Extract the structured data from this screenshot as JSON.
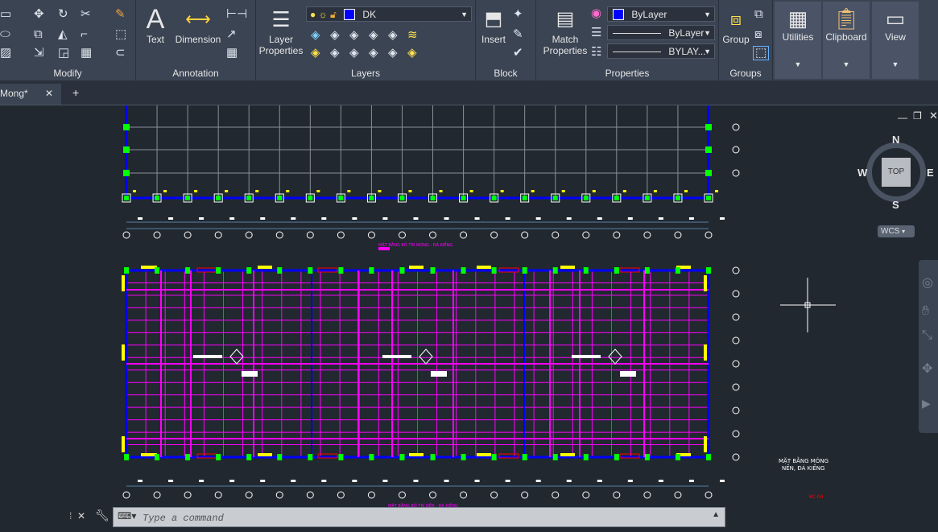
{
  "ribbon": {
    "modify_label": "Modify",
    "annotation_label": "Annotation",
    "annotation_text": "Text",
    "annotation_dimension": "Dimension",
    "layers_label": "Layers",
    "layer_properties": [
      "Layer",
      "Properties"
    ],
    "layer_current": "DK",
    "block_label": "Block",
    "insert": "Insert",
    "properties_label": "Properties",
    "match_properties": [
      "Match",
      "Properties"
    ],
    "color_value": "ByLayer",
    "linetype_value": "ByLayer",
    "lineweight_value": "BYLAY...",
    "groups_label": "Groups",
    "group": "Group",
    "utilities": "Utilities",
    "clipboard": "Clipboard",
    "view": "View",
    "layer_color": "#0000ff"
  },
  "tabs": {
    "drawing": "Mong*"
  },
  "viewcube": {
    "n": "N",
    "s": "S",
    "e": "E",
    "w": "W",
    "top": "TOP",
    "wcs": "WCS"
  },
  "drawing_text": {
    "plan1_title": "MẶT BẰNG BỐ TRÍ MÓNG - ĐÁ KIỀNG",
    "plan2_title": "MẶT BẰNG BỐ TRÍ NỀN - ĐÁ KIỀNG",
    "side_title_1": "MẶT BẰNG MÓNG",
    "side_title_2": "NỀN, ĐÁ KIỀNG",
    "sheet_code": "KC-04"
  },
  "command": {
    "placeholder": "Type a command"
  },
  "colors": {
    "magenta": "#ff00ff",
    "blue": "#0000ff",
    "yellow": "#ffff00",
    "green": "#00ff00",
    "red": "#ff0000",
    "background": "#212830"
  }
}
